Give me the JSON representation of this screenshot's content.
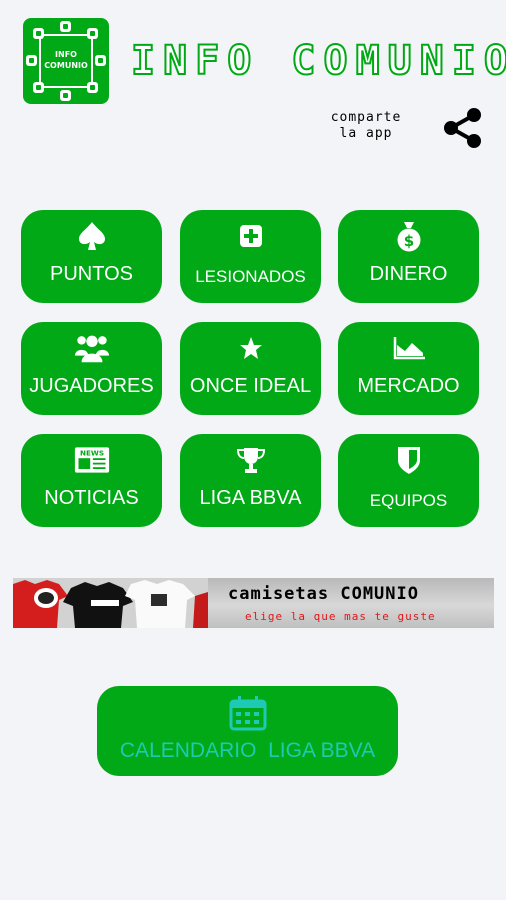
{
  "header": {
    "logo_line1": "INFO",
    "logo_line2": "COMUNIO",
    "title": "INFO COMUNIO",
    "share_line1": "comparte",
    "share_line2": "la app",
    "share_icon": "share-icon"
  },
  "menu": [
    {
      "label": "PUNTOS",
      "icon": "spade-icon"
    },
    {
      "label": "LESIONADOS",
      "icon": "medical-cross-icon"
    },
    {
      "label": "DINERO",
      "icon": "money-bag-icon"
    },
    {
      "label": "JUGADORES",
      "icon": "users-icon"
    },
    {
      "label": "ONCE IDEAL",
      "icon": "star-icon"
    },
    {
      "label": "MERCADO",
      "icon": "area-chart-icon"
    },
    {
      "label": "NOTICIAS",
      "icon": "newspaper-icon"
    },
    {
      "label": "LIGA BBVA",
      "icon": "trophy-icon"
    },
    {
      "label": "EQUIPOS",
      "icon": "shield-icon"
    }
  ],
  "banner": {
    "title": "camisetas COMUNIO",
    "subtitle": "elige la que mas te guste"
  },
  "calendar": {
    "label": "CALENDARIO  LIGA BBVA",
    "icon": "calendar-icon"
  },
  "colors": {
    "brand_green": "#00a915",
    "background": "#f3f4f8",
    "calendar_text": "#1ec9b5",
    "banner_subtitle": "#e01818"
  }
}
